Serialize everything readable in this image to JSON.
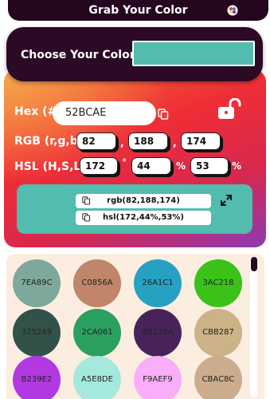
{
  "header": {
    "title": "Grab Your Color",
    "palette_icon": "palette-icon"
  },
  "chooser": {
    "label": "Choose Your Color",
    "swatch_color": "#52bcae"
  },
  "hex": {
    "label": "Hex (#)",
    "value": "52BCAE",
    "copy_icon": "copy-icon"
  },
  "rgb": {
    "label": "RGB (r,g,b)",
    "r": "82",
    "g": "188",
    "b": "174",
    "separator": ","
  },
  "hsl": {
    "label": "HSL (H,S,L)",
    "h": "172",
    "s": "44",
    "l": "53",
    "h_unit": "°",
    "s_unit": "%",
    "l_unit": "%"
  },
  "lock_icon": "unlock-icon",
  "output": {
    "rgb_text": "rgb(82,188,174)",
    "hsl_text": "hsl(172,44%,53%)",
    "expand_icon": "expand-icon"
  },
  "palette": [
    {
      "label": "7EA89C",
      "color": "#7ea89c"
    },
    {
      "label": "C0856A",
      "color": "#c0856a"
    },
    {
      "label": "26A1C1",
      "color": "#26a1c1"
    },
    {
      "label": "3AC218",
      "color": "#3ac218"
    },
    {
      "label": "325249",
      "color": "#325249"
    },
    {
      "label": "2CA061",
      "color": "#2ca061"
    },
    {
      "label": "48235A",
      "color": "#48235a"
    },
    {
      "label": "CBB287",
      "color": "#cbb287"
    },
    {
      "label": "B239E2",
      "color": "#b239e2"
    },
    {
      "label": "A5E8DE",
      "color": "#a5e8de"
    },
    {
      "label": "F9AEF9",
      "color": "#f9aef9"
    },
    {
      "label": "CBAC8C",
      "color": "#cbac8c"
    }
  ]
}
